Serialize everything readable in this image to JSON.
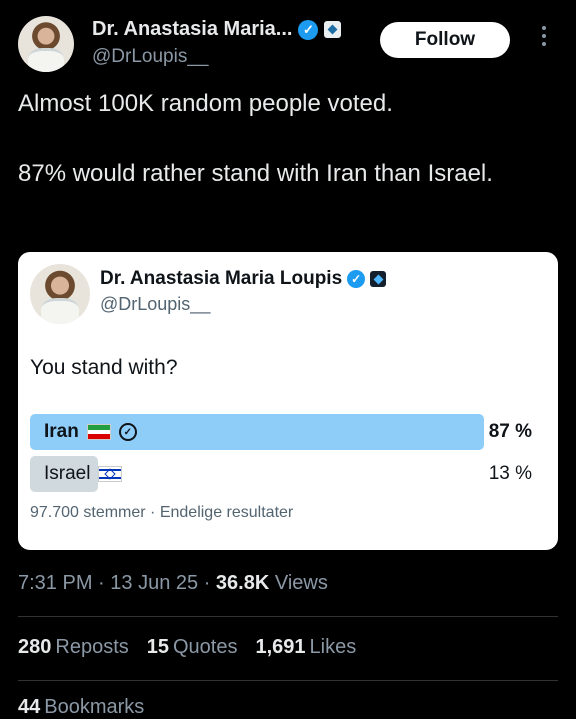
{
  "author": {
    "name": "Dr. Anastasia Maria...",
    "handle": "@DrLoupis__",
    "verified_icon": "verified-badge-icon",
    "affiliate_icon": "affiliate-badge-icon"
  },
  "follow_label": "Follow",
  "tweet": {
    "line1": "Almost 100K random people voted.",
    "line2": "87% would rather stand with Iran than Israel."
  },
  "quote": {
    "name": "Dr. Anastasia Maria Loupis",
    "handle": "@DrLoupis__",
    "question": "You stand with?",
    "options": [
      {
        "label": "Iran",
        "percent_text": "87 %",
        "percent": 87,
        "winner": true,
        "flag_icon": "iran-flag-icon"
      },
      {
        "label": "Israel",
        "percent_text": "13 %",
        "percent": 13,
        "winner": false,
        "flag_icon": "israel-flag-icon"
      }
    ],
    "footer": "97.700 stemmer · Endelige resultater"
  },
  "meta": {
    "time": "7:31 PM",
    "date": "13 Jun 25",
    "views_count": "36.8K",
    "views_label": "Views"
  },
  "stats": [
    {
      "count": "280",
      "label": "Reposts"
    },
    {
      "count": "15",
      "label": "Quotes"
    },
    {
      "count": "1,691",
      "label": "Likes"
    }
  ],
  "bookmarks": {
    "count": "44",
    "label": "Bookmarks"
  },
  "colors": {
    "background": "#000000",
    "winner_bar": "#8ecdf7",
    "loser_bar": "#cfd9de",
    "verified": "#1d9bf0"
  }
}
